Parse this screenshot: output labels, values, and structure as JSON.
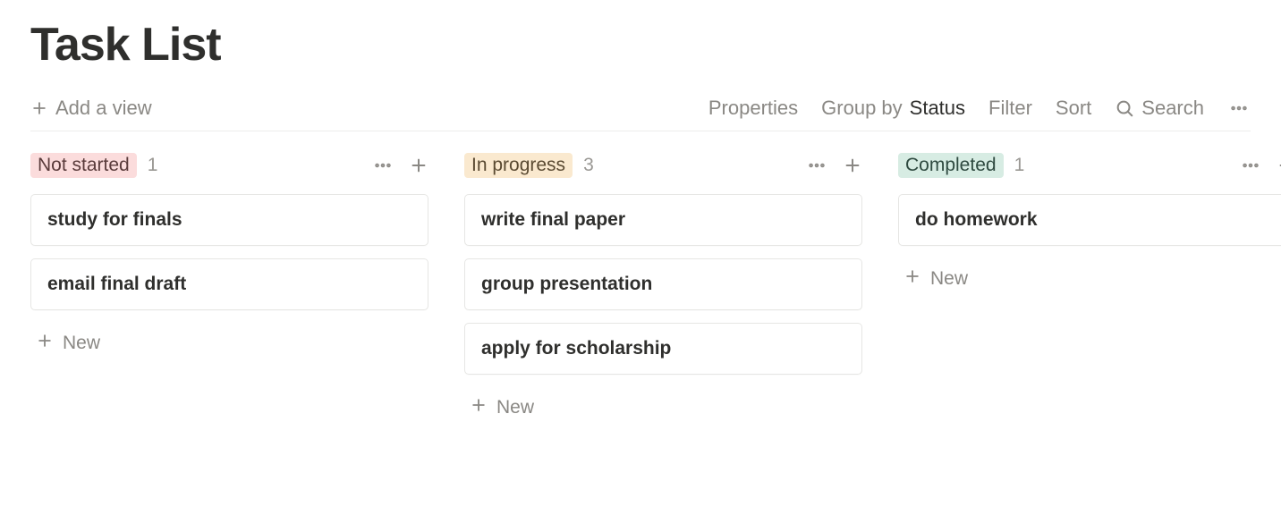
{
  "pageTitle": "Task List",
  "toolbar": {
    "addView": "Add a view",
    "properties": "Properties",
    "groupByPrefix": "Group by ",
    "groupByValue": "Status",
    "filter": "Filter",
    "sort": "Sort",
    "search": "Search"
  },
  "newLabel": "New",
  "columns": [
    {
      "name": "Not started",
      "count": "1",
      "tagClass": "tag-pink",
      "cards": [
        "study for finals",
        "email final draft"
      ]
    },
    {
      "name": "In progress",
      "count": "3",
      "tagClass": "tag-peach",
      "cards": [
        "write final paper",
        "group presentation",
        "apply for scholarship"
      ]
    },
    {
      "name": "Completed",
      "count": "1",
      "tagClass": "tag-mint",
      "cards": [
        "do homework"
      ]
    }
  ]
}
